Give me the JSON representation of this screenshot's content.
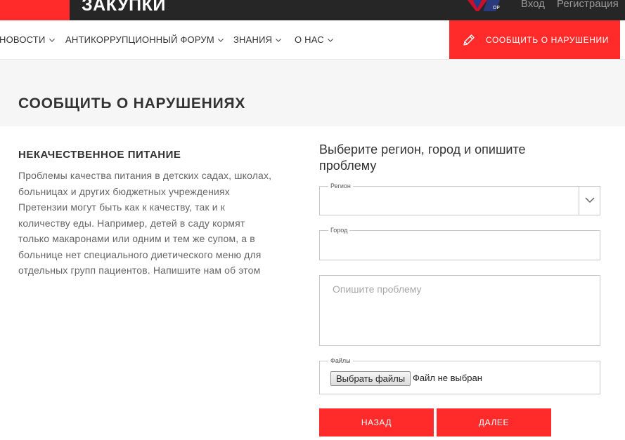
{
  "topbar": {
    "site_title": "ЗАКУПКИ",
    "login": "Вход",
    "register": "Регистрация"
  },
  "nav": {
    "items": [
      {
        "label": "НОВОСТИ"
      },
      {
        "label": "АНТИКОРРУПЦИОННЫЙ ФОРУМ"
      },
      {
        "label": "ЗНАНИЯ"
      },
      {
        "label": "О НАС"
      }
    ],
    "report_button": "СООБЩИТЬ О НАРУШЕНИИ"
  },
  "page": {
    "title": "СООБЩИТЬ О НАРУШЕНИЯХ"
  },
  "category": {
    "title": "НЕКАЧЕСТВЕННОЕ ПИТАНИЕ",
    "lines": [
      "Проблемы качества питания в детских садах, школах,",
      "больницах и других бюджетных учреждениях",
      "Претензии могут быть как к качеству, так и к",
      "количеству еды. Например, детей в саду кормят",
      "только макаронами или одним и тем же супом, а в",
      "больнице нет специального диетического меню для",
      "отдельных групп пациентов. Напишите нам об этом"
    ]
  },
  "form": {
    "heading_line1": "Выберите регион, город и опишите",
    "heading_line2": "проблему",
    "region_label": "Регион",
    "region_value": "",
    "city_label": "Город",
    "city_value": "",
    "problem_placeholder": "Опишите проблему",
    "files_label": "Файлы",
    "choose_files": "Выбрать файлы",
    "no_file": "Файл не выбран",
    "back": "НАЗАД",
    "next": "ДАЛЕЕ"
  },
  "colors": {
    "accent": "#ff2a2a",
    "topbar": "#262626",
    "head_band": "#f6f6f6"
  }
}
